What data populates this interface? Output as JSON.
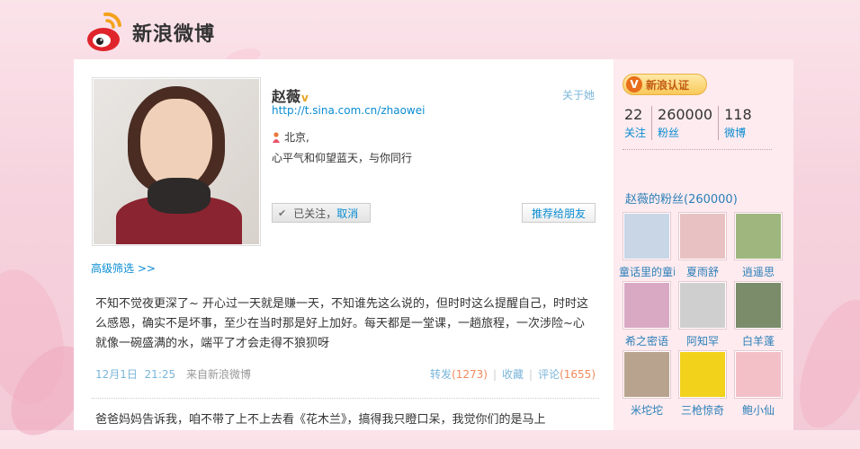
{
  "brand": {
    "name": "新浪微博"
  },
  "profile": {
    "name": "赵薇",
    "verified_mark": "v",
    "follow_link": "关于她",
    "url": "http://t.sina.com.cn/zhaowei",
    "location": "北京,",
    "bio": "心平气和仰望蓝天，与你同行",
    "followed_label": "已关注",
    "cancel_label": "取消",
    "recommend_label": "推荐给朋友"
  },
  "filter": {
    "label": "高级筛选 >>"
  },
  "posts": [
    {
      "text": "不知不觉夜更深了~ 开心过一天就是赚一天，不知谁先这么说的，但时时这么提醒自己，时时这么感恩，确实不是坏事，至少在当时那是好上加好。每天都是一堂课，一趟旅程，一次涉险~心就像一碗盛满的水，端平了才会走得不狼狈呀",
      "date": "12月1日",
      "time": "21:25",
      "source": "来自新浪微博",
      "repost_label": "转发",
      "repost_count": "(1273)",
      "fav_label": "收藏",
      "comment_label": "评论",
      "comment_count": "(1655)"
    },
    {
      "text": "爸爸妈妈告诉我，咱不带了上不上去看《花木兰》，搞得我只瞪口呆，我觉你们的是马上"
    }
  ],
  "sidebar": {
    "cert_label": "新浪认证",
    "stats": [
      {
        "num": "22",
        "label": "关注"
      },
      {
        "num": "260000",
        "label": "粉丝"
      },
      {
        "num": "118",
        "label": "微博"
      }
    ],
    "fans_title": "赵薇的粉丝(260000)",
    "fans": [
      {
        "name": "童话里的童i",
        "color": "#c9d6e6"
      },
      {
        "name": "夏雨舒",
        "color": "#e8c2c2"
      },
      {
        "name": "逍遥思",
        "color": "#9fb77e"
      },
      {
        "name": "希之密语",
        "color": "#d9a9c4"
      },
      {
        "name": "阿知罕",
        "color": "#cfcfcf"
      },
      {
        "name": "白羊蓬",
        "color": "#7a8c6a"
      },
      {
        "name": "米坨坨",
        "color": "#b8a48e"
      },
      {
        "name": "三枪惊奇",
        "color": "#f2d21a"
      },
      {
        "name": "鲍小仙",
        "color": "#f3c0c8"
      }
    ]
  }
}
